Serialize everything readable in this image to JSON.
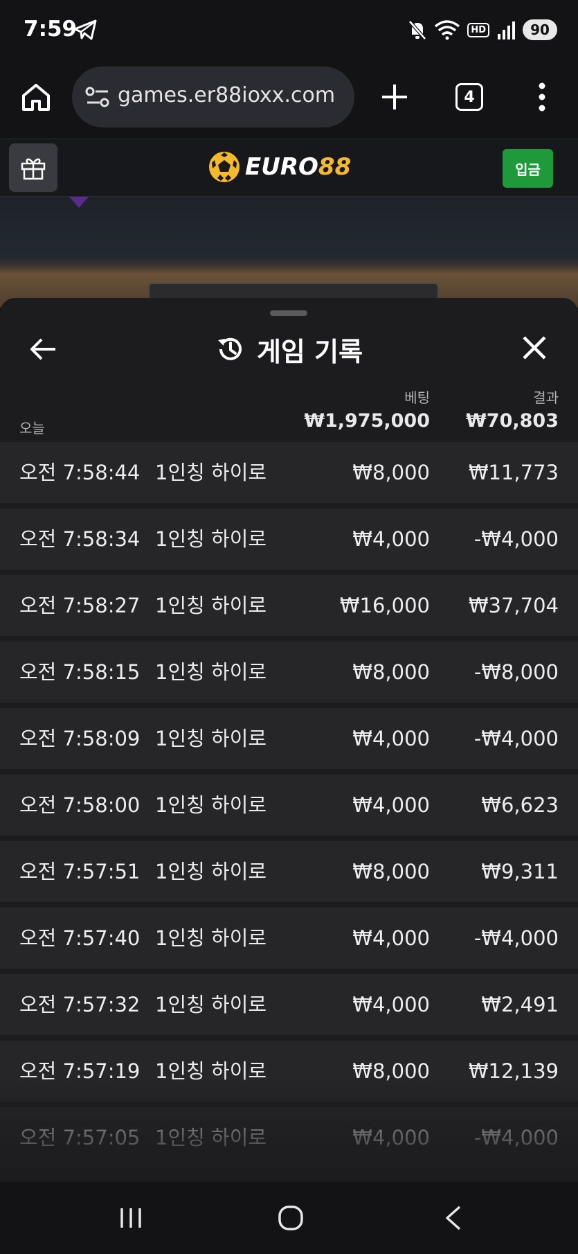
{
  "status_bar": {
    "time": "7:59",
    "battery": "90",
    "hd": "HD"
  },
  "browser": {
    "url": "games.er88ioxx.com",
    "tab_count": "4"
  },
  "site_header": {
    "logo_white": "EURO",
    "logo_yellow": "88",
    "deposit_label": "입금"
  },
  "sheet": {
    "title": "게임 기록",
    "col_bet": "베팅",
    "col_result": "결과",
    "today_label": "오늘",
    "total_bet": "₩1,975,000",
    "total_result": "₩70,803",
    "rows": [
      {
        "time": "오전 7:58:44",
        "game": "1인칭 하이로",
        "bet": "₩8,000",
        "result": "₩11,773"
      },
      {
        "time": "오전 7:58:34",
        "game": "1인칭 하이로",
        "bet": "₩4,000",
        "result": "-₩4,000"
      },
      {
        "time": "오전 7:58:27",
        "game": "1인칭 하이로",
        "bet": "₩16,000",
        "result": "₩37,704"
      },
      {
        "time": "오전 7:58:15",
        "game": "1인칭 하이로",
        "bet": "₩8,000",
        "result": "-₩8,000"
      },
      {
        "time": "오전 7:58:09",
        "game": "1인칭 하이로",
        "bet": "₩4,000",
        "result": "-₩4,000"
      },
      {
        "time": "오전 7:58:00",
        "game": "1인칭 하이로",
        "bet": "₩4,000",
        "result": "₩6,623"
      },
      {
        "time": "오전 7:57:51",
        "game": "1인칭 하이로",
        "bet": "₩8,000",
        "result": "₩9,311"
      },
      {
        "time": "오전 7:57:40",
        "game": "1인칭 하이로",
        "bet": "₩4,000",
        "result": "-₩4,000"
      },
      {
        "time": "오전 7:57:32",
        "game": "1인칭 하이로",
        "bet": "₩4,000",
        "result": "₩2,491"
      },
      {
        "time": "오전 7:57:19",
        "game": "1인칭 하이로",
        "bet": "₩8,000",
        "result": "₩12,139"
      },
      {
        "time": "오전 7:57:05",
        "game": "1인칭 하이로",
        "bet": "₩4,000",
        "result": "-₩4,000"
      }
    ]
  },
  "colors": {
    "accent_gold": "#f5b92a",
    "deposit_green": "#1f9a3a"
  },
  "icons": [
    "telegram-icon",
    "mute-icon",
    "wifi-icon",
    "signal-icon",
    "home-icon",
    "tune-icon",
    "plus-icon",
    "tabs-icon",
    "more-vert-icon",
    "gift-icon",
    "soccer-ball-icon",
    "back-arrow-icon",
    "history-icon",
    "close-icon",
    "recent-apps-icon",
    "nav-home-icon",
    "nav-back-icon"
  ]
}
